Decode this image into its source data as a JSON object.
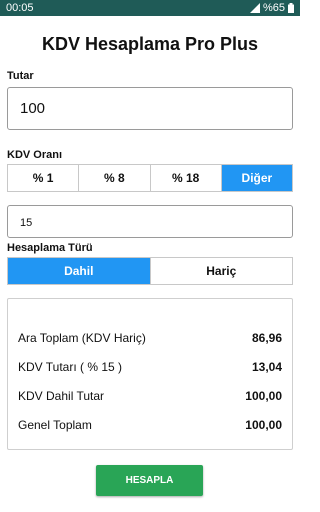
{
  "status_bar": {
    "time": "00:05",
    "battery": "%65"
  },
  "app": {
    "title": "KDV Hesaplama Pro Plus"
  },
  "amount": {
    "label": "Tutar",
    "value": "100"
  },
  "kdv_rate": {
    "label": "KDV Oranı",
    "options": [
      "% 1",
      "% 8",
      "% 18",
      "Diğer"
    ],
    "selected": "Diğer",
    "custom_value": "15"
  },
  "calc_type": {
    "label": "Hesaplama Türü",
    "options": [
      "Dahil",
      "Hariç"
    ],
    "selected": "Dahil"
  },
  "results": [
    {
      "label": "Ara Toplam (KDV Hariç)",
      "value": "86,96"
    },
    {
      "label": "KDV Tutarı ( % 15 )",
      "value": "13,04"
    },
    {
      "label": "KDV Dahil Tutar",
      "value": "100,00"
    },
    {
      "label": "Genel Toplam",
      "value": "100,00"
    }
  ],
  "calculate_button": {
    "label": "HESAPLA"
  },
  "colors": {
    "status_bar": "#1f5b57",
    "accent": "#2196f3",
    "button": "#29a556"
  }
}
